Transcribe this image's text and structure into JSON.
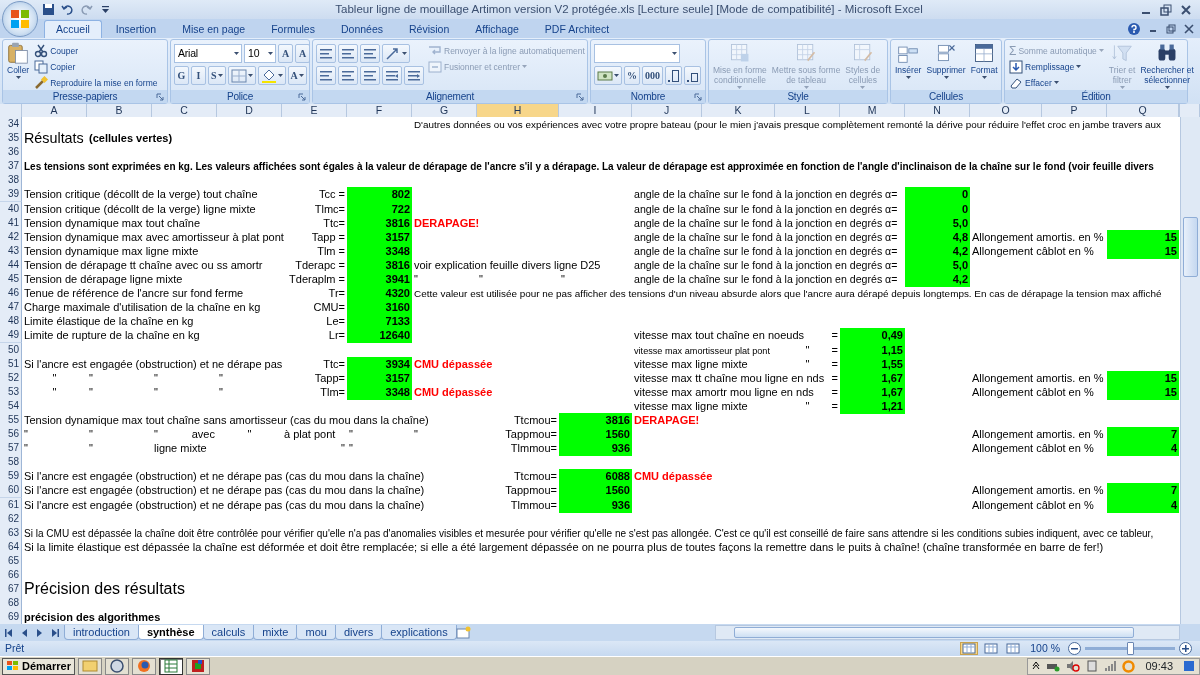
{
  "title_bar": {
    "title": "Tableur ligne de mouillage Artimon version V2 protégée.xls  [Lecture seule]  [Mode de compatibilité] - Microsoft Excel"
  },
  "tabs": [
    {
      "label": "Accueil",
      "selected": true
    },
    {
      "label": "Insertion",
      "selected": false
    },
    {
      "label": "Mise en page",
      "selected": false
    },
    {
      "label": "Formules",
      "selected": false
    },
    {
      "label": "Données",
      "selected": false
    },
    {
      "label": "Révision",
      "selected": false
    },
    {
      "label": "Affichage",
      "selected": false
    },
    {
      "label": "PDF Architect",
      "selected": false
    }
  ],
  "ribbon": {
    "groups": [
      {
        "label": "Presse-papiers",
        "launcher": true,
        "sections": [
          {
            "kind": "large",
            "items": [
              {
                "lines": [
                  "Coller"
                ],
                "dropdown": true,
                "disabled": false
              }
            ]
          },
          {
            "kind": "stack",
            "items": [
              {
                "label": "Couper",
                "disabled": false
              },
              {
                "label": "Copier",
                "disabled": false
              },
              {
                "label": "Reproduire la mise en forme",
                "disabled": false
              }
            ]
          }
        ]
      },
      {
        "label": "Police",
        "launcher": true,
        "sections": [
          {
            "kind": "rows",
            "rows": [
              [
                {
                  "kind": "field",
                  "value": "Arial"
                },
                {
                  "kind": "field",
                  "value": "10"
                },
                {
                  "kind": "tool",
                  "label": "A"
                },
                {
                  "kind": "tool",
                  "label": "A"
                }
              ],
              [
                {
                  "kind": "tool",
                  "label": "G"
                },
                {
                  "kind": "tool",
                  "label": "I"
                },
                {
                  "kind": "tool",
                  "label": "S",
                  "dropdown": true
                },
                {
                  "kind": "tool",
                  "dropdown": true
                },
                {
                  "kind": "tool",
                  "dropdown": true
                },
                {
                  "kind": "tool",
                  "label": "A",
                  "dropdown": true
                }
              ]
            ]
          }
        ]
      },
      {
        "label": "Alignement",
        "launcher": true,
        "sections": [
          {
            "kind": "rows",
            "rows": [
              [
                {
                  "kind": "tool"
                },
                {
                  "kind": "tool"
                },
                {
                  "kind": "tool"
                },
                {
                  "kind": "tool",
                  "dropdown": true
                }
              ],
              [
                {
                  "kind": "tool"
                },
                {
                  "kind": "tool"
                },
                {
                  "kind": "tool"
                },
                {
                  "kind": "tool"
                },
                {
                  "kind": "tool"
                }
              ]
            ]
          },
          {
            "kind": "stack",
            "items": [
              {
                "label": "Renvoyer à la ligne automatiquement",
                "disabled": true
              },
              {
                "label": "Fusionner et centrer",
                "dropdown": true,
                "disabled": true
              }
            ]
          }
        ]
      },
      {
        "label": "Nombre",
        "launcher": true,
        "sections": [
          {
            "kind": "rows",
            "rows": [
              [
                {
                  "kind": "field"
                }
              ],
              [
                {
                  "kind": "tool",
                  "dropdown": true
                },
                {
                  "kind": "tool",
                  "label": "%"
                },
                {
                  "kind": "tool",
                  "label": "000"
                },
                {
                  "kind": "tool"
                },
                {
                  "kind": "tool"
                }
              ]
            ]
          }
        ]
      },
      {
        "label": "Style",
        "launcher": false,
        "sections": [
          {
            "kind": "large",
            "items": [
              {
                "lines": [
                  "Mise en forme",
                  "conditionnelle"
                ],
                "dropdown": true,
                "disabled": true
              },
              {
                "lines": [
                  "Mettre sous forme",
                  "de tableau"
                ],
                "dropdown": true,
                "disabled": true
              },
              {
                "lines": [
                  "Styles de",
                  "cellules"
                ],
                "dropdown": true,
                "disabled": true
              }
            ]
          }
        ]
      },
      {
        "label": "Cellules",
        "launcher": false,
        "sections": [
          {
            "kind": "large",
            "items": [
              {
                "lines": [
                  "Insérer"
                ],
                "dropdown": true,
                "disabled": false
              },
              {
                "lines": [
                  "Supprimer"
                ],
                "dropdown": true,
                "disabled": false
              },
              {
                "lines": [
                  "Format"
                ],
                "dropdown": true,
                "disabled": false
              }
            ]
          }
        ]
      },
      {
        "label": "Édition",
        "launcher": false,
        "sections": [
          {
            "kind": "stack",
            "items": [
              {
                "symbol": "Σ",
                "label": "Somme automatique",
                "dropdown": true,
                "disabled": true
              },
              {
                "label": "Remplissage",
                "dropdown": true,
                "disabled": false
              },
              {
                "label": "Effacer",
                "dropdown": true,
                "disabled": false
              }
            ]
          },
          {
            "kind": "large",
            "items": [
              {
                "lines": [
                  "Trier et",
                  "filtrer"
                ],
                "dropdown": true,
                "disabled": true
              },
              {
                "lines": [
                  "Rechercher et",
                  "sélectionner"
                ],
                "dropdown": true,
                "disabled": false
              }
            ]
          }
        ]
      }
    ]
  },
  "columns": [
    {
      "letter": "A",
      "selected": false
    },
    {
      "letter": "B",
      "selected": false
    },
    {
      "letter": "C",
      "selected": false
    },
    {
      "letter": "D",
      "selected": false
    },
    {
      "letter": "E",
      "selected": false
    },
    {
      "letter": "F",
      "selected": false
    },
    {
      "letter": "G",
      "selected": false
    },
    {
      "letter": "H",
      "selected": true
    },
    {
      "letter": "I",
      "selected": false
    },
    {
      "letter": "J",
      "selected": false
    },
    {
      "letter": "K",
      "selected": false
    },
    {
      "letter": "L",
      "selected": false
    },
    {
      "letter": "M",
      "selected": false
    },
    {
      "letter": "N",
      "selected": false
    },
    {
      "letter": "O",
      "selected": false
    },
    {
      "letter": "P",
      "selected": false
    },
    {
      "letter": "Q",
      "selected": false
    }
  ],
  "rows": [
    {
      "number": "34",
      "cells": {
        "G": {
          "kind": "text",
          "text": "D'autres données ou vos expériences avec votre propre bateau (pour le mien j'avais presque complètement remonté la dérive pour réduire l'effet croc en jambe travers aux"
        }
      }
    },
    {
      "number": "35",
      "cells": {
        "A": {
          "kind": "heading",
          "text": "Résultats"
        },
        "B": {
          "kind": "bold",
          "text": "(cellules vertes)"
        }
      }
    },
    {
      "number": "36"
    },
    {
      "number": "37",
      "cells": {
        "A": {
          "kind": "bold",
          "text": "Les tensions sont exprimées en kg. Les valeurs affichées sont égales à la valeur de dérapage de l'ancre s'il y a dérapage. La valeur de dérapage est approximée en fonction de l'angle d'inclinaison de la chaîne sur le fond (voir feuille divers"
        }
      }
    },
    {
      "number": "38"
    },
    {
      "number": "39",
      "cells": {
        "A": {
          "kind": "text",
          "text": "Tension critique (décollt de la verge) tout chaîne"
        },
        "E": {
          "kind": "right",
          "text": "Tcc ="
        },
        "F": {
          "kind": "value",
          "text": "802"
        },
        "J": {
          "kind": "text",
          "text": "angle de la chaîne sur le fond à la jonction en degrés α="
        },
        "N": {
          "kind": "value",
          "text": "0"
        }
      }
    },
    {
      "number": "40",
      "cells": {
        "A": {
          "kind": "text",
          "text": "Tension critique (décollt de la verge) ligne mixte"
        },
        "E": {
          "kind": "right",
          "text": "Tlmc="
        },
        "F": {
          "kind": "value",
          "text": "722"
        },
        "J": {
          "kind": "text",
          "text": "angle de la chaîne sur le fond à la jonction en degrés α="
        },
        "N": {
          "kind": "value",
          "text": "0"
        }
      }
    },
    {
      "number": "41",
      "cells": {
        "A": {
          "kind": "text",
          "text": "Tension dynamique max tout chaîne"
        },
        "E": {
          "kind": "right",
          "text": "Ttc="
        },
        "F": {
          "kind": "value",
          "text": "3816"
        },
        "G": {
          "kind": "alert",
          "text": "DERAPAGE!"
        },
        "J": {
          "kind": "text",
          "text": "angle de la chaîne sur le fond à la jonction en degrés α="
        },
        "N": {
          "kind": "value",
          "text": "5,0"
        }
      }
    },
    {
      "number": "42",
      "cells": {
        "A": {
          "kind": "text",
          "text": "Tension dynamique max avec amortisseur à plat pont"
        },
        "E": {
          "kind": "right",
          "text": "Tapp ="
        },
        "F": {
          "kind": "value",
          "text": "3157"
        },
        "J": {
          "kind": "text",
          "text": "angle de la chaîne sur le fond à la jonction en degrés α="
        },
        "N": {
          "kind": "value",
          "text": "4,8"
        },
        "O": {
          "kind": "text",
          "text": "Allongement amortis. en %"
        },
        "Q": {
          "kind": "value",
          "text": "15"
        }
      }
    },
    {
      "number": "43",
      "cells": {
        "A": {
          "kind": "text",
          "text": "Tension dynamique max ligne mixte"
        },
        "E": {
          "kind": "right",
          "text": "Tlm ="
        },
        "F": {
          "kind": "value",
          "text": "3348"
        },
        "J": {
          "kind": "text",
          "text": "angle de la chaîne sur le fond à la jonction en degrés α="
        },
        "N": {
          "kind": "value",
          "text": "4,2"
        },
        "O": {
          "kind": "text",
          "text": "Allongement câblot en %"
        },
        "Q": {
          "kind": "value",
          "text": "15"
        }
      }
    },
    {
      "number": "44",
      "cells": {
        "A": {
          "kind": "text",
          "text": "Tension de dérapage tt chaîne avec ou ss amortr"
        },
        "E": {
          "kind": "right",
          "text": "Tderapc ="
        },
        "F": {
          "kind": "value",
          "text": "3816"
        },
        "G": {
          "kind": "text",
          "text": "voir explication feuille divers ligne D25"
        },
        "J": {
          "kind": "text",
          "text": "angle de la chaîne sur le fond à la jonction en degrés α="
        },
        "N": {
          "kind": "value",
          "text": "5,0"
        }
      }
    },
    {
      "number": "45",
      "cells": {
        "A": {
          "kind": "text",
          "text": "Tension de dérapage ligne mixte"
        },
        "E": {
          "kind": "right",
          "text": "Tderaplm ="
        },
        "F": {
          "kind": "value",
          "text": "3941"
        },
        "G": {
          "kind": "text",
          "text": "\""
        },
        "H": {
          "kind": "text",
          "text": "\""
        },
        "I": {
          "kind": "text",
          "text": "\""
        },
        "J": {
          "kind": "text",
          "text": "angle de la chaîne sur le fond à la jonction en degrés α="
        },
        "N": {
          "kind": "value",
          "text": "4,2"
        }
      }
    },
    {
      "number": "46",
      "cells": {
        "A": {
          "kind": "text",
          "text": "Tenue de référence de l'ancre sur fond ferme"
        },
        "E": {
          "kind": "right",
          "text": "Tr="
        },
        "F": {
          "kind": "value",
          "text": "4320"
        },
        "G": {
          "kind": "text",
          "text": "Cette valeur est utilisée pour ne pas afficher des tensions d'un niveau absurde alors que l'ancre aura dérapé depuis longtemps. En cas de dérapage la tension max affiché"
        }
      }
    },
    {
      "number": "47",
      "cells": {
        "A": {
          "kind": "text",
          "text": "Charge maximale d'utilisation de la chaîne en kg"
        },
        "E": {
          "kind": "right",
          "text": "CMU="
        },
        "F": {
          "kind": "value",
          "text": "3160"
        }
      }
    },
    {
      "number": "48",
      "cells": {
        "A": {
          "kind": "text",
          "text": "Limite élastique de la chaîne en kg"
        },
        "E": {
          "kind": "right",
          "text": "Le="
        },
        "F": {
          "kind": "value",
          "text": "7133"
        }
      }
    },
    {
      "number": "49",
      "cells": {
        "A": {
          "kind": "text",
          "text": "Limite de rupture de la chaîne en kg"
        },
        "E": {
          "kind": "right",
          "text": "Lr="
        },
        "F": {
          "kind": "value",
          "text": "12640"
        },
        "J": {
          "kind": "text",
          "text": "vitesse max tout chaîne en noeuds"
        },
        "L": {
          "kind": "right",
          "text": "="
        },
        "M": {
          "kind": "value",
          "text": "0,49"
        }
      }
    },
    {
      "number": "50",
      "cells": {
        "J": {
          "kind": "text",
          "text": "vitesse max amortisseur plat pont"
        },
        "L": [
          {
            "kind": "center",
            "text": "\""
          },
          {
            "kind": "right",
            "text": "="
          }
        ],
        "M": {
          "kind": "value",
          "text": "1,15"
        }
      }
    },
    {
      "number": "51",
      "cells": {
        "A": {
          "kind": "text",
          "text": "Si l'ancre est engagée (obstruction)  et ne dérape pas"
        },
        "E": {
          "kind": "right",
          "text": "Ttc="
        },
        "F": {
          "kind": "value",
          "text": "3934"
        },
        "G": {
          "kind": "alert",
          "text": "CMU dépassée"
        },
        "J": {
          "kind": "text",
          "text": "vitesse max ligne mixte"
        },
        "L": [
          {
            "kind": "center",
            "text": "\""
          },
          {
            "kind": "right",
            "text": "="
          }
        ],
        "M": {
          "kind": "value",
          "text": "1,55"
        }
      }
    },
    {
      "number": "52",
      "cells": {
        "A": {
          "kind": "center",
          "text": "\""
        },
        "B": {
          "kind": "text",
          "text": "\""
        },
        "C": {
          "kind": "text",
          "text": "\""
        },
        "D": {
          "kind": "text",
          "text": "\""
        },
        "E": {
          "kind": "right",
          "text": "Tapp="
        },
        "F": {
          "kind": "value",
          "text": "3157"
        },
        "J": {
          "kind": "text",
          "text": "vitesse max tt chaîne mou ligne en nds"
        },
        "L": {
          "kind": "right",
          "text": "="
        },
        "M": {
          "kind": "value",
          "text": "1,67"
        },
        "O": {
          "kind": "text",
          "text": "Allongement amortis. en %"
        },
        "Q": {
          "kind": "value",
          "text": "15"
        }
      }
    },
    {
      "number": "53",
      "cells": {
        "A": {
          "kind": "center",
          "text": "\""
        },
        "B": {
          "kind": "text",
          "text": "\""
        },
        "C": {
          "kind": "text",
          "text": "\""
        },
        "D": {
          "kind": "text",
          "text": "\""
        },
        "E": {
          "kind": "right",
          "text": "Tlm="
        },
        "F": {
          "kind": "value",
          "text": "3348"
        },
        "G": {
          "kind": "alert",
          "text": "CMU dépassée"
        },
        "J": {
          "kind": "text",
          "text": "vitesse max amortr mou ligne en nds"
        },
        "L": {
          "kind": "right",
          "text": "="
        },
        "M": {
          "kind": "value",
          "text": "1,67"
        },
        "O": {
          "kind": "text",
          "text": "Allongement câblot en %"
        },
        "Q": {
          "kind": "value",
          "text": "15"
        }
      }
    },
    {
      "number": "54",
      "cells": {
        "J": {
          "kind": "text",
          "text": "vitesse max ligne mixte"
        },
        "L": [
          {
            "kind": "center",
            "text": "\""
          },
          {
            "kind": "right",
            "text": "="
          }
        ],
        "M": {
          "kind": "value",
          "text": "1,21"
        }
      }
    },
    {
      "number": "55",
      "cells": {
        "A": {
          "kind": "text",
          "text": "Tension dynamique max tout chaîne sans amortisseur (cas du mou dans la chaîne)"
        },
        "H": {
          "kind": "right",
          "text": "Ttcmou="
        },
        "I": {
          "kind": "value",
          "text": "3816"
        },
        "J": {
          "kind": "alert",
          "text": "DERAPAGE!"
        }
      }
    },
    {
      "number": "56",
      "cells": {
        "A": {
          "kind": "text",
          "text": "\""
        },
        "B": {
          "kind": "text",
          "text": "\""
        },
        "C": [
          {
            "kind": "text",
            "text": "\""
          },
          {
            "kind": "right",
            "text": "avec"
          }
        ],
        "D": {
          "kind": "center",
          "text": "\""
        },
        "E": {
          "kind": "text",
          "text": "à plat pont"
        },
        "F": {
          "kind": "text",
          "text": "\""
        },
        "G": {
          "kind": "text",
          "text": "\""
        },
        "H": {
          "kind": "right",
          "text": "Tappmou="
        },
        "I": {
          "kind": "value",
          "text": "1560"
        },
        "O": {
          "kind": "text",
          "text": "Allongement amortis. en %"
        },
        "Q": {
          "kind": "value",
          "text": "7"
        }
      }
    },
    {
      "number": "57",
      "cells": {
        "A": {
          "kind": "text",
          "text": "\""
        },
        "B": {
          "kind": "text",
          "text": "\""
        },
        "C": {
          "kind": "text",
          "text": "ligne mixte"
        },
        "E": {
          "kind": "right",
          "text": "\""
        },
        "F": {
          "kind": "text",
          "text": "\""
        },
        "H": {
          "kind": "right",
          "text": "Tlmmou="
        },
        "I": {
          "kind": "value",
          "text": "936"
        },
        "O": {
          "kind": "text",
          "text": "Allongement câblot en %"
        },
        "Q": {
          "kind": "value",
          "text": "4"
        }
      }
    },
    {
      "number": "58"
    },
    {
      "number": "59",
      "cells": {
        "A": {
          "kind": "text",
          "text": "Si l'ancre est engagée (obstruction)  et ne dérape pas (cas du mou dans la chaîne)"
        },
        "H": {
          "kind": "right",
          "text": "Ttcmou="
        },
        "I": {
          "kind": "value",
          "text": "6088"
        },
        "J": {
          "kind": "alert",
          "text": "CMU dépassée"
        }
      }
    },
    {
      "number": "60",
      "cells": {
        "A": {
          "kind": "text",
          "text": "Si l'ancre est engagée (obstruction)  et ne dérape pas (cas du mou dans la chaîne)"
        },
        "H": {
          "kind": "right",
          "text": "Tappmou="
        },
        "I": {
          "kind": "value",
          "text": "1560"
        },
        "O": {
          "kind": "text",
          "text": "Allongement amortis. en %"
        },
        "Q": {
          "kind": "value",
          "text": "7"
        }
      }
    },
    {
      "number": "61",
      "cells": {
        "A": {
          "kind": "text",
          "text": "Si l'ancre est engagée (obstruction)  et ne dérape pas (cas du mou dans la chaîne)"
        },
        "H": {
          "kind": "right",
          "text": "Tlmmou="
        },
        "I": {
          "kind": "value",
          "text": "936"
        },
        "O": {
          "kind": "text",
          "text": "Allongement câblot en %"
        },
        "Q": {
          "kind": "value",
          "text": "4"
        }
      }
    },
    {
      "number": "62"
    },
    {
      "number": "63",
      "cells": {
        "A": {
          "kind": "text",
          "text": "Si la CMU est dépassée la chaîne doit être contrôlée pour vérifier qu'elle n'a pas d'anomalies visibles et mesurée pour vérifier qu'elle ne s'est pas allongée. C'est ce qu'il est conseillé de faire sans attendre si les conditions subies indiquent, avec ce tableur,"
        }
      }
    },
    {
      "number": "64",
      "cells": {
        "A": {
          "kind": "text",
          "text": "Si la limite élastique est dépassée la chaîne est déformée et doit être remplacée; si elle a été largement dépassée on ne pourra plus de toutes façons la remettre dans le puits à chaîne! (chaîne transformée en barre de fer!)"
        }
      }
    },
    {
      "number": "65"
    },
    {
      "number": "66"
    },
    {
      "number": "67",
      "cells": {
        "A": {
          "kind": "heading",
          "text": "Précision des résultats"
        }
      }
    },
    {
      "number": "68"
    },
    {
      "number": "69",
      "cells": {
        "A": {
          "kind": "bold",
          "text": "précision des algorithmes"
        }
      }
    }
  ],
  "sheet_tabs": [
    {
      "label": "introduction",
      "selected": false
    },
    {
      "label": "synthèse",
      "selected": true
    },
    {
      "label": "calculs",
      "selected": false
    },
    {
      "label": "mixte",
      "selected": false
    },
    {
      "label": "mou",
      "selected": false
    },
    {
      "label": "divers",
      "selected": false
    },
    {
      "label": "explications",
      "selected": false
    }
  ],
  "status_bar": {
    "text": "Prêt",
    "views": [
      {
        "selected": true
      },
      {
        "selected": false
      },
      {
        "selected": false
      }
    ],
    "zoom": {
      "reading": "100 %",
      "level": 0.5
    }
  },
  "taskbar": {
    "start": "Démarrer",
    "apps": [
      {
        "selected": false
      },
      {
        "selected": false
      },
      {
        "selected": false
      },
      {
        "selected": true
      },
      {
        "selected": false
      }
    ],
    "clock": "09:43"
  }
}
